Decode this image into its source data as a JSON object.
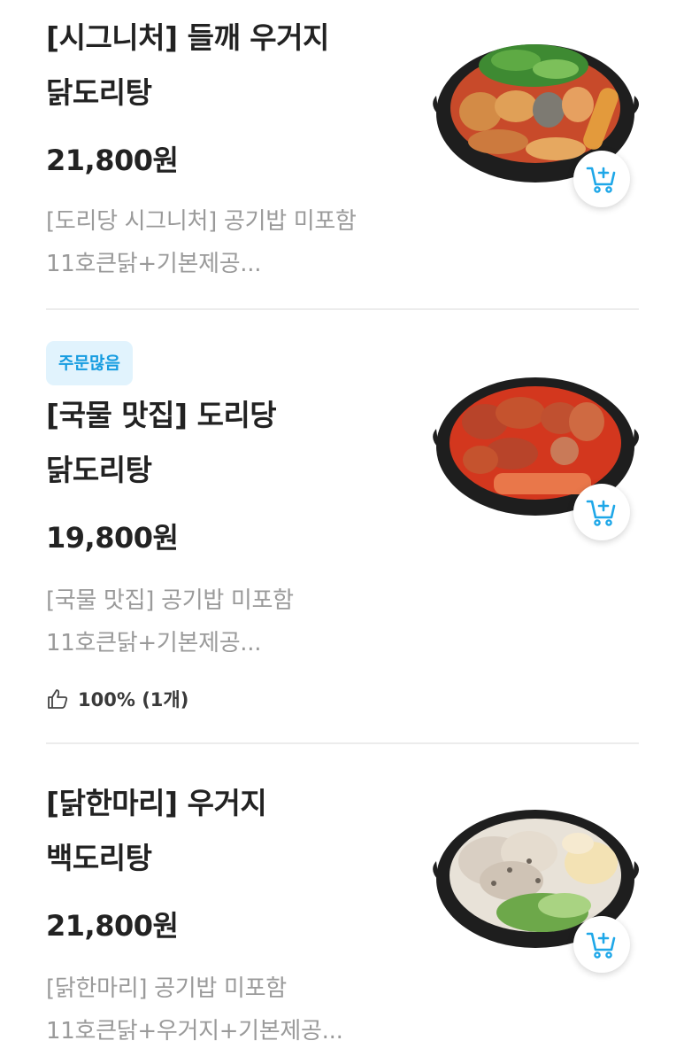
{
  "items": [
    {
      "title_line1": "[시그니처] 들깨 우거지",
      "title_line2": "닭도리탕",
      "price": "21,800원",
      "desc_line1": "[도리당 시그니처] 공기밥 미포함",
      "desc_line2": "11호큰닭+기본제공..."
    },
    {
      "badge": "주문많음",
      "title_line1": "[국물 맛집] 도리당",
      "title_line2": "닭도리탕",
      "price": "19,800원",
      "desc_line1": "[국물 맛집] 공기밥 미포함",
      "desc_line2": "11호큰닭+기본제공...",
      "rating": "100% (1개)"
    },
    {
      "title_line1": "[닭한마리] 우거지",
      "title_line2": "백도리탕",
      "price": "21,800원",
      "desc_line1": "[닭한마리]  공기밥 미포함",
      "desc_line2": "11호큰닭+우거지+기본제공..."
    }
  ],
  "colors": {
    "badge_bg": "#e1f3fd",
    "badge_text": "#169ce0",
    "cart_icon": "#1ea7e8",
    "divider": "#ececec"
  },
  "icons": {
    "cart": "cart-add-icon",
    "like": "thumbs-up-icon"
  }
}
